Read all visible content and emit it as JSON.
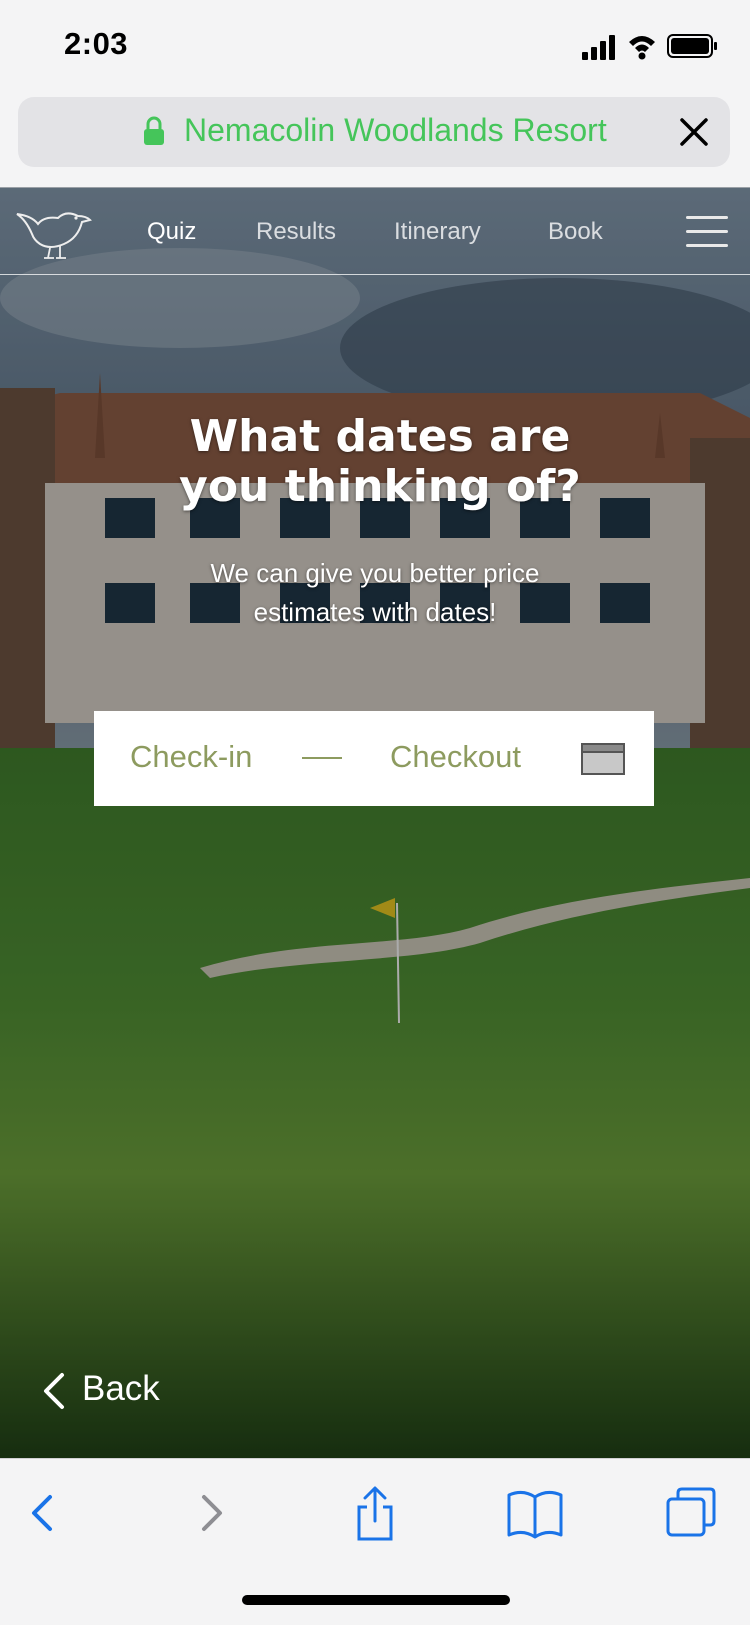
{
  "status_bar": {
    "time": "2:03"
  },
  "url_bar": {
    "site_name": "Nemacolin Woodlands Resort"
  },
  "nav": {
    "items": [
      {
        "label": "Quiz",
        "active": true
      },
      {
        "label": "Results",
        "active": false
      },
      {
        "label": "Itinerary",
        "active": false
      },
      {
        "label": "Book",
        "active": false
      }
    ]
  },
  "hero": {
    "question_line1": "What dates are",
    "question_line2": "you thinking of?",
    "subtitle": "We can give you better price estimates with dates!"
  },
  "date_picker": {
    "checkin_placeholder": "Check-in",
    "checkout_placeholder": "Checkout"
  },
  "back": {
    "label": "Back"
  },
  "colors": {
    "url_green": "#45c55a",
    "placeholder_olive": "#8d9b5f",
    "ios_blue": "#1a73e8"
  },
  "icons": [
    "lock-icon",
    "close-icon",
    "bird-logo-icon",
    "hamburger-menu-icon",
    "calendar-icon",
    "chevron-left-icon",
    "browser-back-icon",
    "browser-forward-icon",
    "share-icon",
    "bookmarks-icon",
    "tabs-icon"
  ]
}
